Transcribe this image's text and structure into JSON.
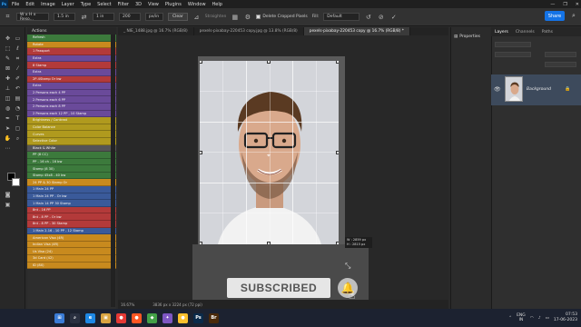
{
  "app": {
    "logo": "Ps"
  },
  "menu": [
    "File",
    "Edit",
    "Image",
    "Layer",
    "Type",
    "Select",
    "Filter",
    "3D",
    "View",
    "Plugins",
    "Window",
    "Help"
  ],
  "window_controls": [
    "—",
    "❐",
    "✕"
  ],
  "options": {
    "ratio": "W x H x Reso...",
    "width": "1.5 in",
    "height": "1 in",
    "resolution": "200",
    "res_unit": "px/in",
    "clear": "Clear",
    "straighten": "Straighten",
    "delete_cropped": "Delete Cropped Pixels",
    "fill_label": "Fill:",
    "fill_value": "Default",
    "share": "Share"
  },
  "actions": {
    "title": "Actions",
    "items": [
      {
        "label": "Refresh",
        "color": "#3c7a3c"
      },
      {
        "label": "Rotate",
        "color": "#c88a1e"
      },
      {
        "label": "1 Passport",
        "color": "#b33a3a"
      },
      {
        "label": "Extra",
        "color": "#6a4a9a"
      },
      {
        "label": "8 Stamp",
        "color": "#b33a3a"
      },
      {
        "label": "Extra",
        "color": "#6a4a9a"
      },
      {
        "label": "2P-4Stamp Or bw",
        "color": "#b33a3a"
      },
      {
        "label": "Extra",
        "color": "#6a4a9a"
      },
      {
        "label": "2 Persons each 4 PP",
        "color": "#6a4a9a"
      },
      {
        "label": "2 Persons each 6 PP",
        "color": "#6a4a9a"
      },
      {
        "label": "2 Persons each 8 PP",
        "color": "#6a4a9a"
      },
      {
        "label": "2 Persons each 12 PP , 10 Stamp",
        "color": "#6a4a9a"
      },
      {
        "label": "Brightness / Contrast",
        "color": "#b09a1e"
      },
      {
        "label": "Color Balance",
        "color": "#b09a1e"
      },
      {
        "label": "Curves",
        "color": "#b09a1e"
      },
      {
        "label": "Selective Color",
        "color": "#b09a1e"
      },
      {
        "label": "Black & White",
        "color": "#555555"
      },
      {
        "label": "PP (8 CC)",
        "color": "#3c7a3c"
      },
      {
        "label": "PP - 16 ch - 16 bw",
        "color": "#3c7a3c"
      },
      {
        "label": "Stamp (8 30)",
        "color": "#3c7a3c"
      },
      {
        "label": "Stamp 45x8 - 40 bw",
        "color": "#3c7a3c"
      },
      {
        "label": "24 PP & 30 Stamp Or",
        "color": "#c88a1e"
      },
      {
        "label": "1 Main 24 PP",
        "color": "#3a5a9a"
      },
      {
        "label": "1 Main 24 PP - Or bw",
        "color": "#3a5a9a"
      },
      {
        "label": "1 Main 14 PP 30 Stamp",
        "color": "#3a5a9a"
      },
      {
        "label": "8nt - 16 PP",
        "color": "#b33a3a"
      },
      {
        "label": "8nt - 8 PP - Or bw",
        "color": "#b33a3a"
      },
      {
        "label": "8nt - 8 PP - 30 Stamp",
        "color": "#b33a3a"
      },
      {
        "label": "1 Main 2-16 - 10 PP - 12 Stamp",
        "color": "#3a5a9a"
      },
      {
        "label": "American Visa (4R)",
        "color": "#c88a1e"
      },
      {
        "label": "Indian Visa (4R)",
        "color": "#c88a1e"
      },
      {
        "label": "Us Visa (24)",
        "color": "#c88a1e"
      },
      {
        "label": "3d Card (42)",
        "color": "#c88a1e"
      },
      {
        "label": "ID (8X)",
        "color": "#c88a1e"
      }
    ]
  },
  "tabs": [
    {
      "label": "_ NIE_1488.jpg @ 16.7% (RGB/8)",
      "active": false
    },
    {
      "label": "pexels-pixabay-220453 copy.jpg @ 13.8% (RGB/8)",
      "active": false
    },
    {
      "label": "pexels-pixabay-220453 copy @ 16.7% (RGB/8) *",
      "active": true
    }
  ],
  "crop_dims": {
    "w": "W : 2859 px",
    "h": "H : 2815 px"
  },
  "overlay": {
    "subscribed": "SUBSCRIBED",
    "bell": "🔔"
  },
  "status": {
    "zoom": "16.67%",
    "doc": "3836 px x 3224 px (72 ppi)"
  },
  "properties": {
    "label": "Properties"
  },
  "layers": {
    "tabs": [
      "Layers",
      "Channels",
      "Paths"
    ],
    "layer_name": "Background"
  },
  "taskbar": {
    "apps": [
      {
        "glyph": "⊞",
        "color": "#3a7bd5"
      },
      {
        "glyph": "⌕",
        "color": "#2a3040"
      },
      {
        "glyph": "e",
        "color": "#1e88e5"
      },
      {
        "glyph": "▣",
        "color": "#d9a441"
      },
      {
        "glyph": "●",
        "color": "#e53935"
      },
      {
        "glyph": "●",
        "color": "#ff5722"
      },
      {
        "glyph": "◆",
        "color": "#43a047"
      },
      {
        "glyph": "✦",
        "color": "#7e57c2"
      },
      {
        "glyph": "●",
        "color": "#fbc02d"
      },
      {
        "glyph": "Ps",
        "color": "#0a2a4a"
      },
      {
        "glyph": "Br",
        "color": "#4a2a0a"
      }
    ],
    "lang": "ENG",
    "region": "IN",
    "time": "07:53",
    "date": "17-06-2023"
  }
}
